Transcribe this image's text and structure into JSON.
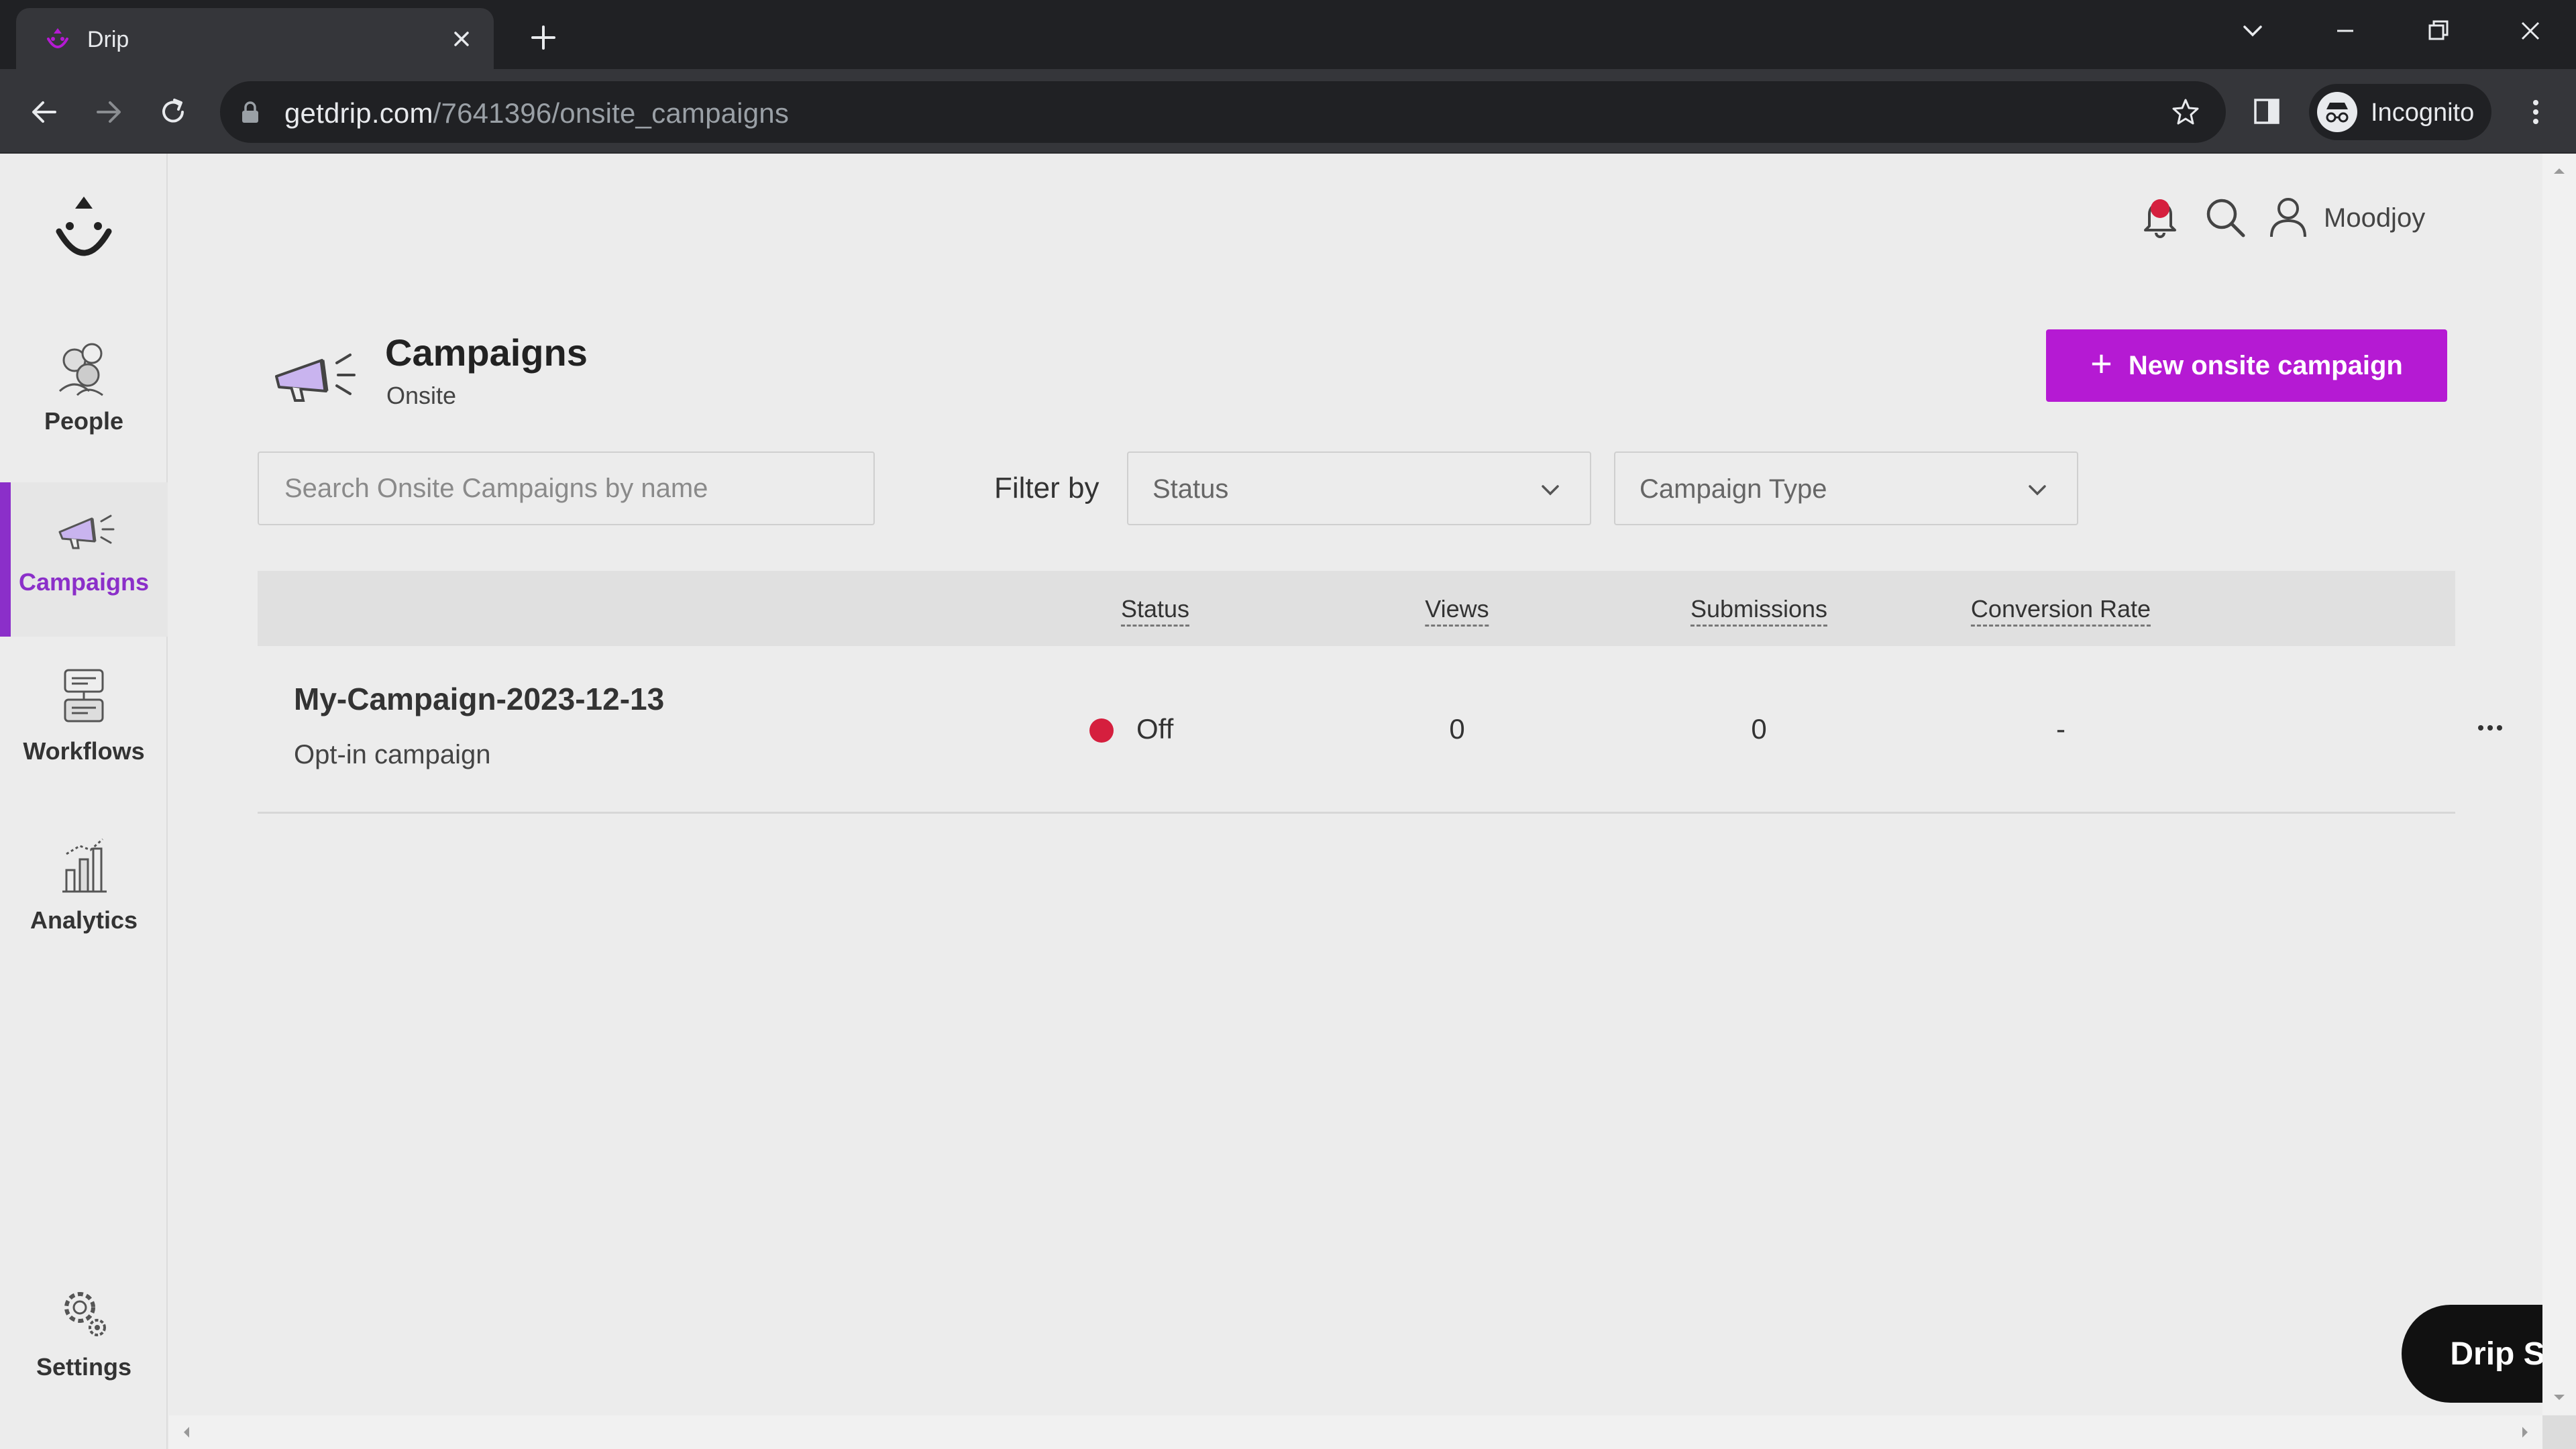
{
  "browser": {
    "tab_title": "Drip",
    "url_host": "getdrip.com",
    "url_path": "/7641396/onsite_campaigns",
    "profile_label": "Incognito"
  },
  "nav": {
    "items": [
      {
        "label": "People",
        "icon": "people-icon"
      },
      {
        "label": "Campaigns",
        "icon": "megaphone-icon",
        "active": true
      },
      {
        "label": "Workflows",
        "icon": "workflows-icon"
      },
      {
        "label": "Analytics",
        "icon": "analytics-icon"
      },
      {
        "label": "Settings",
        "icon": "gear-icon"
      }
    ]
  },
  "header": {
    "username": "Moodjoy"
  },
  "page": {
    "title": "Campaigns",
    "subtitle": "Onsite",
    "new_button": "New onsite campaign"
  },
  "filters": {
    "search_placeholder": "Search Onsite Campaigns by name",
    "filter_label": "Filter by",
    "status_select": "Status",
    "type_select": "Campaign Type"
  },
  "table": {
    "columns": [
      "Status",
      "Views",
      "Submissions",
      "Conversion Rate"
    ],
    "rows": [
      {
        "name": "My-Campaign-2023-12-13",
        "type": "Opt-in campaign",
        "status": "Off",
        "views": "0",
        "submissions": "0",
        "conversion_rate": "-"
      }
    ]
  },
  "support_button": "Drip Support",
  "colors": {
    "accent": "#b51ad3",
    "nav_active": "#8b2fc9",
    "status_off": "#d51f3e"
  }
}
